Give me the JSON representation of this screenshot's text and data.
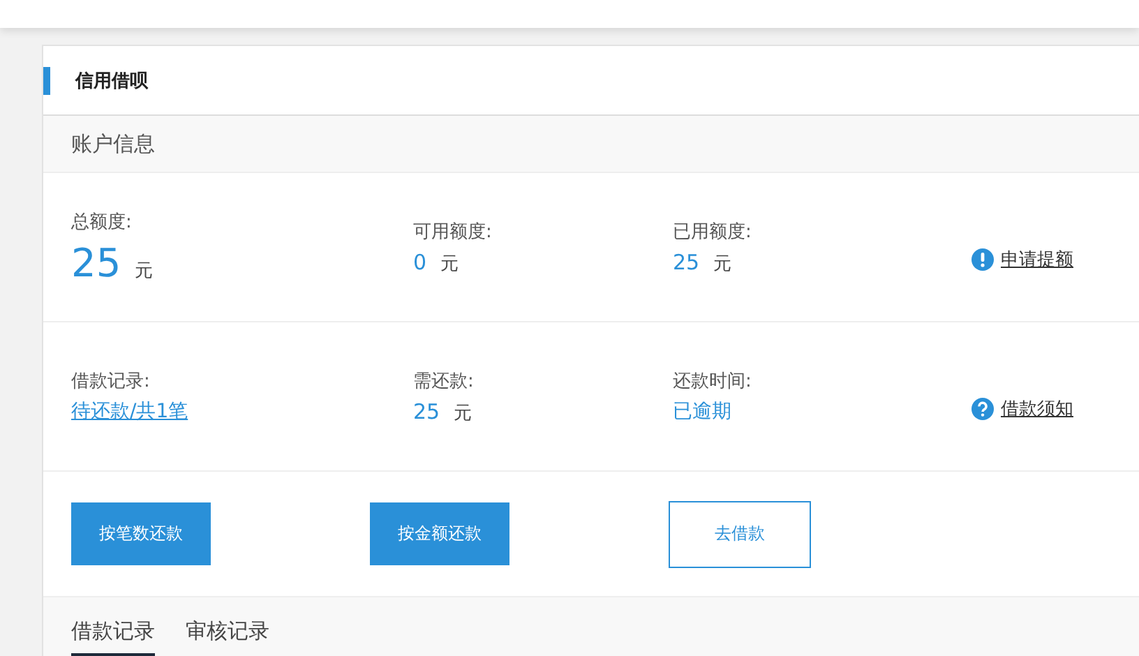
{
  "panel": {
    "title": "信用借呗"
  },
  "section": {
    "title": "账户信息"
  },
  "info_rows": [
    {
      "items": [
        {
          "label": "总额度:",
          "value": "25",
          "unit": "元",
          "kind": "big"
        },
        {
          "label": "可用额度:",
          "value": "0",
          "unit": "元",
          "kind": "amount"
        },
        {
          "label": "已用额度:",
          "value": "25",
          "unit": "元",
          "kind": "amount"
        }
      ],
      "action": {
        "label": "申请提额",
        "kind": "exclaim"
      }
    },
    {
      "items": [
        {
          "label": "借款记录:",
          "value": "待还款/共1笔",
          "kind": "link"
        },
        {
          "label": "需还款:",
          "value": "25",
          "unit": "元",
          "kind": "amount"
        },
        {
          "label": "还款时间:",
          "value": "已逾期",
          "kind": "status"
        }
      ],
      "action": {
        "label": "借款须知",
        "kind": "question"
      }
    }
  ],
  "buttons": [
    {
      "label": "按笔数还款",
      "kind": "solid"
    },
    {
      "label": "按金额还款",
      "kind": "solid"
    },
    {
      "label": "去借款",
      "kind": "outline"
    }
  ],
  "tabs": [
    {
      "label": "借款记录",
      "selected": true
    },
    {
      "label": "审核记录",
      "selected": false
    }
  ]
}
